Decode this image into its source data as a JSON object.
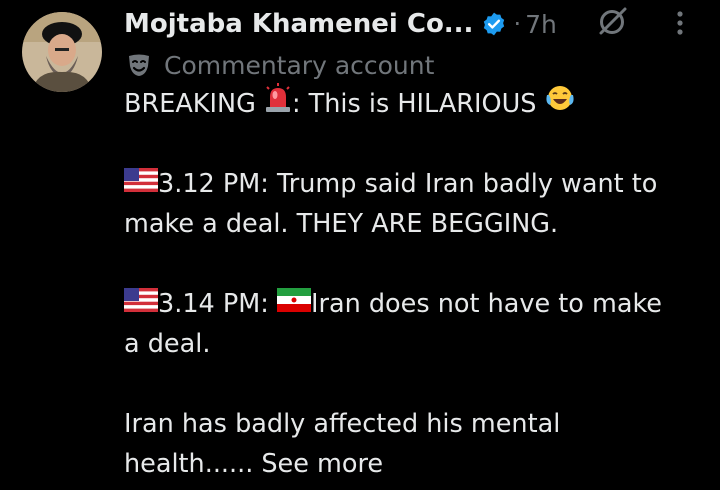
{
  "author": {
    "display_name": "Mojtaba Khamenei Co...",
    "timestamp": "7h",
    "separator": "·",
    "label": "Commentary account"
  },
  "icons": {
    "verified": "verified-badge-icon",
    "grok": "grok-icon",
    "more": "more-options-icon",
    "label": "theater-mask-icon"
  },
  "colors": {
    "background": "#000000",
    "text": "#e7e9ea",
    "secondary": "#71767b",
    "verified": "#1d9bf0"
  },
  "post": {
    "line1_a": "BREAKING ",
    "line1_b": ": This is HILARIOUS ",
    "line2": "3.12 PM: Trump said Iran badly want to",
    "line3": "make a deal. THEY ARE BEGGING.",
    "line4_a": "3.14 PM: ",
    "line4_b": "Iran does not have to make",
    "line5": "a deal.",
    "line6": "Iran has badly affected his mental",
    "line7": "health......",
    "see_more": "See more"
  }
}
